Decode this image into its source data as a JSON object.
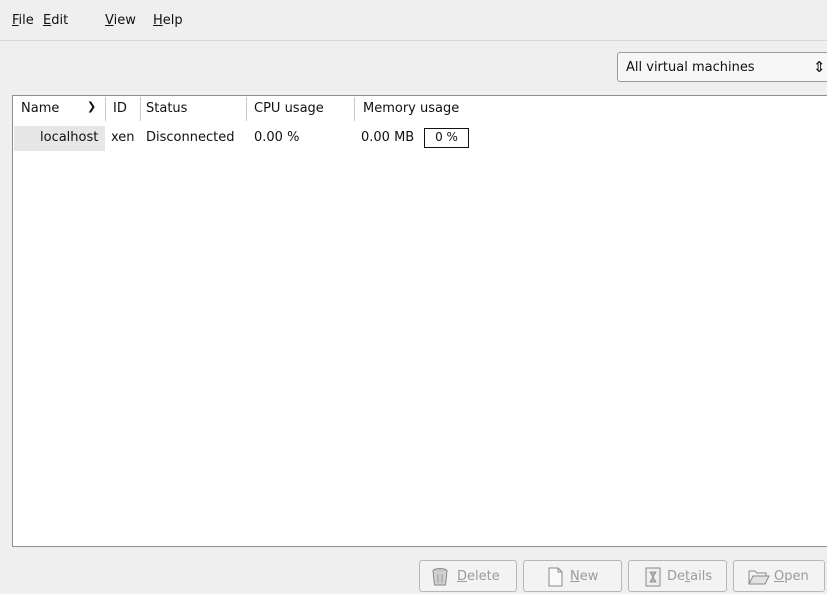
{
  "menu": {
    "file": {
      "mnemonic": "F",
      "rest": "ile"
    },
    "edit": {
      "mnemonic": "E",
      "rest": "dit"
    },
    "view": {
      "mnemonic": "V",
      "rest": "iew"
    },
    "help": {
      "mnemonic": "H",
      "rest": "elp"
    }
  },
  "filter": {
    "selected": "All virtual machines"
  },
  "columns": {
    "name": "Name",
    "id": "ID",
    "status": "Status",
    "cpu": "CPU usage",
    "memory": "Memory usage"
  },
  "rows": [
    {
      "name": "localhost",
      "id": "xen",
      "status": "Disconnected",
      "cpu": "0.00 %",
      "memory": "0.00 MB",
      "memory_percent": "0 %"
    }
  ],
  "buttons": {
    "delete": {
      "pre": "",
      "mnemonic": "D",
      "post": "elete"
    },
    "new": {
      "pre": "",
      "mnemonic": "N",
      "post": "ew"
    },
    "details": {
      "pre": "De",
      "mnemonic": "t",
      "post": "ails"
    },
    "open": {
      "pre": "",
      "mnemonic": "O",
      "post": "pen"
    }
  },
  "icons": [
    "chevron-down-icon",
    "updown-arrow-icon",
    "trash-icon",
    "new-document-icon",
    "details-icon",
    "folder-open-icon"
  ]
}
